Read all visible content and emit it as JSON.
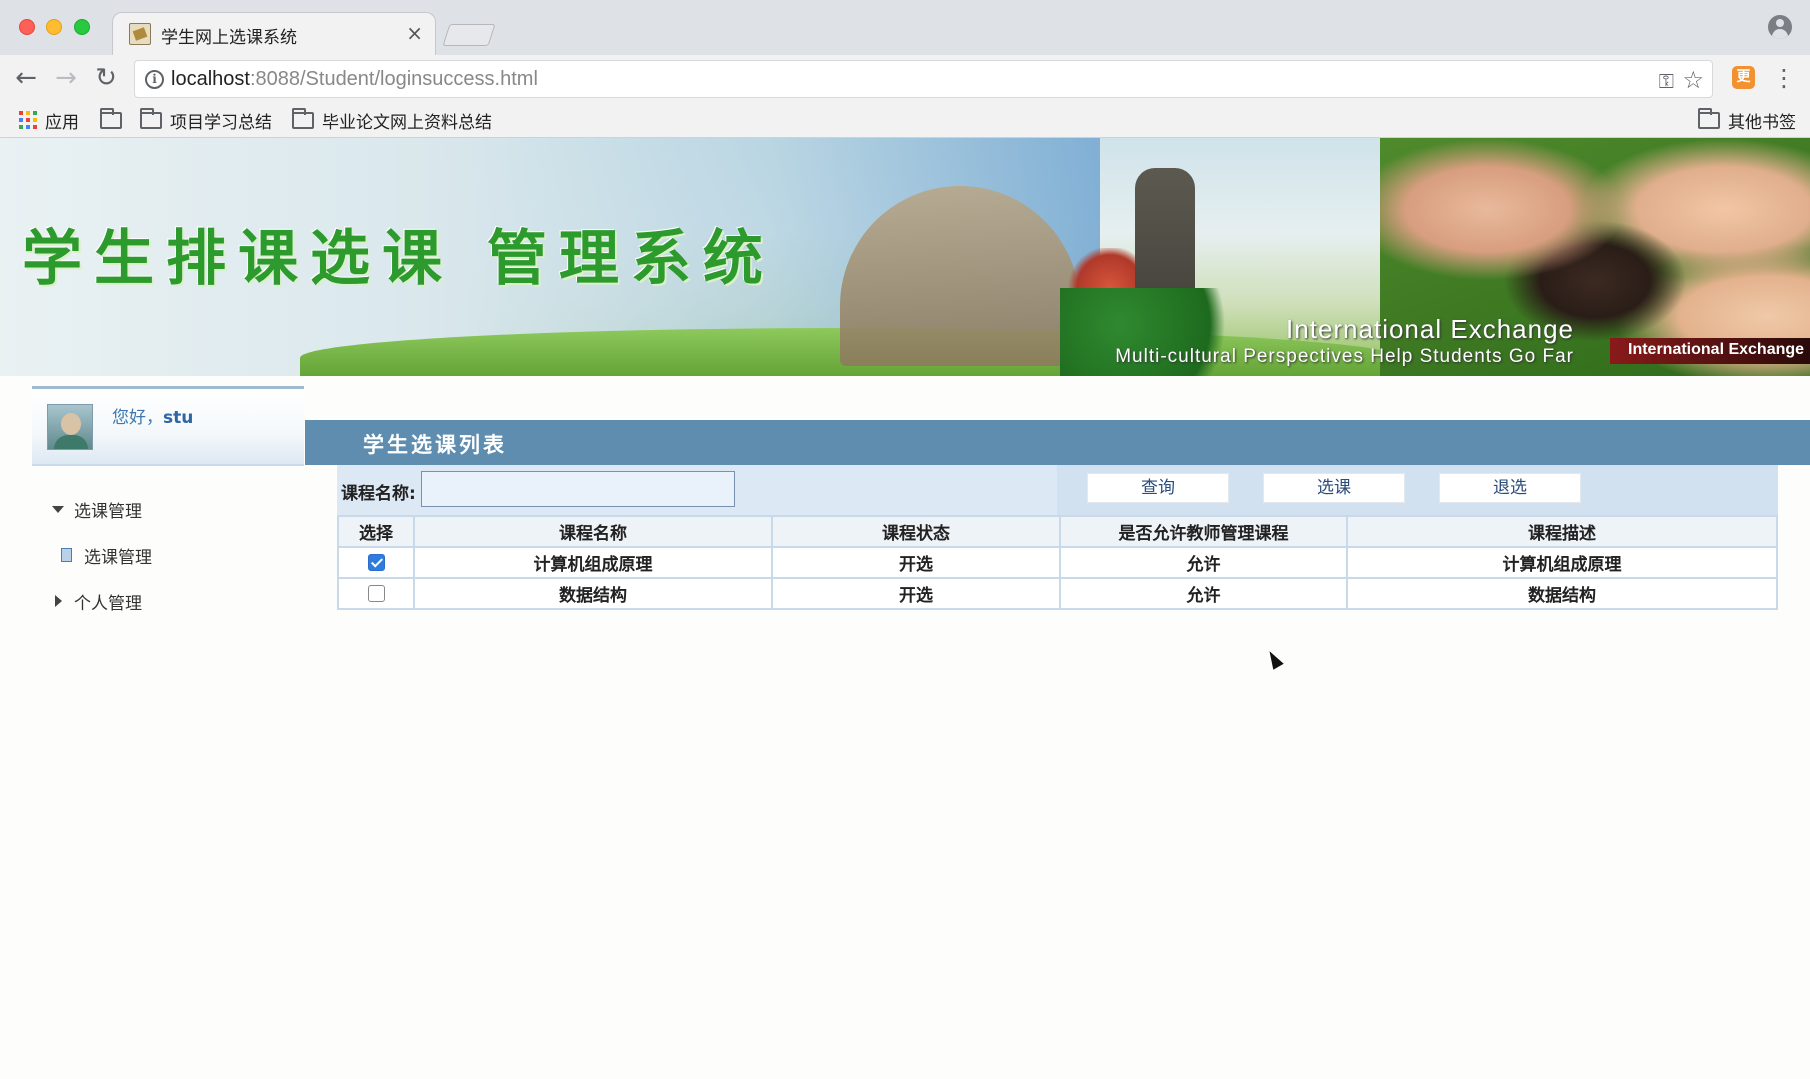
{
  "browser": {
    "tab_title": "学生网上选课系统",
    "tab_close": "×",
    "url_host": "localhost",
    "url_rest": ":8088/Student/loginsuccess.html",
    "ext_label": "更",
    "bookmarks": {
      "apps": "应用",
      "folder1": "",
      "folder2": "项目学习总结",
      "folder3": "毕业论文网上资料总结",
      "other": "其他书签"
    }
  },
  "banner": {
    "title": "学生排课选课 管理系统",
    "subtitle_en": "International Exchange",
    "tagline_en": "Multi-cultural Perspectives Help Students Go Far",
    "side_en": "International Exchange"
  },
  "user": {
    "greeting": "您好，",
    "username": "stu"
  },
  "sidebar": {
    "items": [
      {
        "label": "选课管理",
        "expanded": true
      },
      {
        "label": "选课管理",
        "child": true
      },
      {
        "label": "个人管理",
        "expanded": false
      }
    ]
  },
  "panel": {
    "title": "学生选课列表",
    "search_label": "课程名称:",
    "search_value": "",
    "buttons": {
      "query": "查询",
      "select": "选课",
      "withdraw": "退选"
    }
  },
  "table": {
    "headers": [
      "选择",
      "课程名称",
      "课程状态",
      "是否允许教师管理课程",
      "课程描述"
    ],
    "rows": [
      {
        "checked": true,
        "name": "计算机组成原理",
        "status": "开选",
        "allow": "允许",
        "desc": "计算机组成原理"
      },
      {
        "checked": false,
        "name": "数据结构",
        "status": "开选",
        "allow": "允许",
        "desc": "数据结构"
      }
    ]
  },
  "colors": {
    "panel_header": "#5e8db0",
    "search_bar": "#dce8f4",
    "greeting": "#3c76b0",
    "checkbox_checked": "#2f7ce0"
  }
}
